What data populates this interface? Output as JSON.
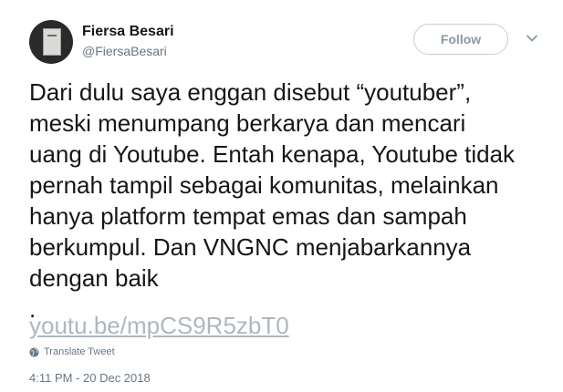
{
  "author": {
    "name": "Fiersa Besari",
    "handle": "@FiersaBesari"
  },
  "actions": {
    "follow_label": "Follow",
    "more_icon": "chevron-down-icon"
  },
  "tweet": {
    "text": "Dari dulu saya enggan disebut “youtuber”,\nmeski menumpang berkarya dan mencari\nuang di Youtube. Entah kenapa, Youtube tidak\npernah tampil sebagai komunitas, melainkan\nhanya platform tempat emas dan sampah\nberkumpul. Dan VNGNC menjabarkannya\ndengan baik\n.",
    "link": "youtu.be/mpCS9R5zbT0",
    "translate_label": "Translate Tweet",
    "translate_icon": "globe-icon",
    "timestamp": "4:11 PM - 20 Dec 2018"
  },
  "colors": {
    "text": "#14171a",
    "secondary": "#657786",
    "link": "#abb8c2",
    "border": "#c4cfd6"
  }
}
